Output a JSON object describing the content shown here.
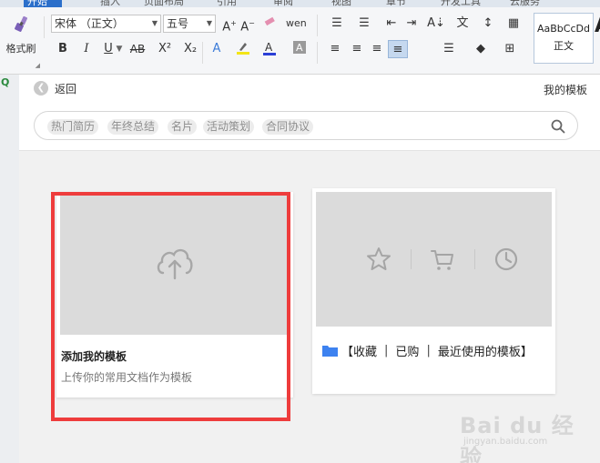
{
  "ribbon": {
    "tabs": [
      "开始",
      "插入",
      "页面布局",
      "引用",
      "审阅",
      "视图",
      "章节",
      "开发工具",
      "云服务"
    ],
    "format_painter_label": "格式刷",
    "font_name": "宋体 （正文）",
    "font_size": "五号",
    "bold": "B",
    "italic": "I",
    "underline": "U",
    "strikethrough": "AB",
    "superscript": "X²",
    "subscript": "X₂",
    "styles_preview": "AaBbCcDd",
    "styles_name": "正文",
    "styles_next": "A"
  },
  "topbar": {
    "back_label": "返回",
    "my_templates": "我的模板"
  },
  "search": {
    "chips": [
      "热门简历",
      "年终总结",
      "名片",
      "活动策划",
      "合同协议"
    ]
  },
  "card_add": {
    "title": "添加我的模板",
    "subtitle": "上传你的常用文档作为模板"
  },
  "card_collections": {
    "bracket_open": "【",
    "items": [
      "收藏",
      "已购",
      "最近使用的模板"
    ],
    "separator": "|",
    "bracket_close": "】"
  },
  "watermark": {
    "main": "Bai du 经验",
    "sub": "jingyan.baidu.com"
  },
  "colors": {
    "highlight": "#ee3c3c",
    "tab_active": "#2b6fca",
    "folder": "#3d82f0"
  }
}
